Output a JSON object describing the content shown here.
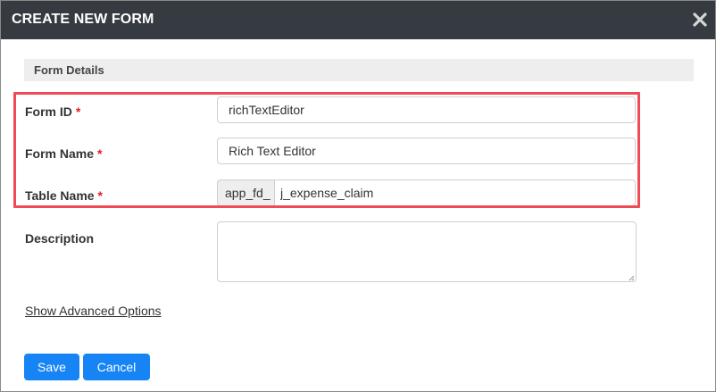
{
  "dialog": {
    "title": "CREATE NEW FORM",
    "close_icon": "close-x-icon"
  },
  "section": {
    "title": "Form Details"
  },
  "fields": {
    "form_id": {
      "label": "Form ID",
      "required_mark": "*",
      "value": "richTextEditor"
    },
    "form_name": {
      "label": "Form Name",
      "required_mark": "*",
      "value": "Rich Text Editor"
    },
    "table_name": {
      "label": "Table Name",
      "required_mark": "*",
      "prefix": "app_fd_",
      "value": "j_expense_claim"
    },
    "description": {
      "label": "Description",
      "value": ""
    }
  },
  "links": {
    "advanced": "Show Advanced Options"
  },
  "buttons": {
    "save": "Save",
    "cancel": "Cancel"
  },
  "colors": {
    "titlebar": "#353b40",
    "highlight": "#ef4a55",
    "primary_button": "#1684f5",
    "required": "#e02020"
  }
}
